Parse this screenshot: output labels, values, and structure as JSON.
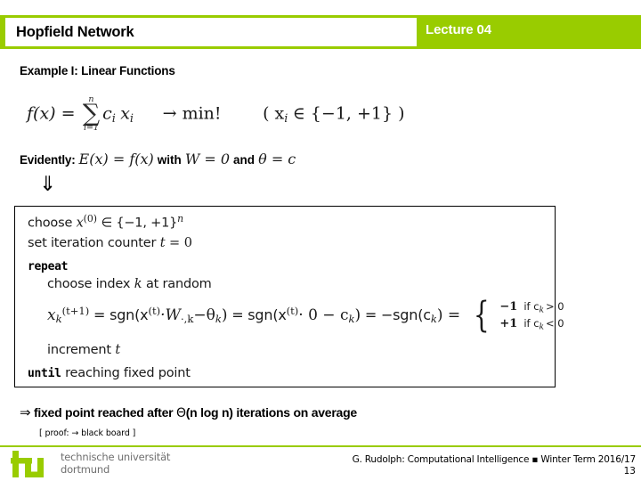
{
  "colors": {
    "accent_green": "#99CC00",
    "logo_gray": "#6f6f6f",
    "text": "#000000"
  },
  "header": {
    "title": "Hopfield Network",
    "lecture": "Lecture 04"
  },
  "content": {
    "example_heading": "Example I: Linear Functions",
    "formula_main": {
      "lhs": "f(x) =",
      "sum_upper": "n",
      "sum_sign": "∑",
      "sum_lower": "i=1",
      "summand_c": "c",
      "summand_c_sub": "i",
      "summand_x": "x",
      "summand_x_sub": "i",
      "objective": "→ min!",
      "constraint": "( x",
      "constraint_sub": "i",
      "constraint_rest": "∈ {−1, +1} )"
    },
    "evidently": {
      "label": "Evidently:",
      "expr_e": "E(x) = f(x)",
      "with": "with",
      "expr_w": "W = 0",
      "and": "and",
      "expr_theta": "θ = c"
    },
    "implication_arrow": "⇓"
  },
  "algorithm": {
    "line_choose": {
      "kw": "choose",
      "var": "x",
      "sup": "(0)",
      "rest": "∈ {−1, +1}",
      "rest_sup": "n"
    },
    "line_set_counter": {
      "kw": "set iteration counter",
      "var": "t",
      "rest": "= 0"
    },
    "line_repeat": "repeat",
    "line_choose_index": {
      "kw": "choose index",
      "var": "k",
      "rest": "at random"
    },
    "line_update": {
      "lhs_x": "x",
      "lhs_sub": "k",
      "lhs_sup": "(t+1)",
      "eq1": "= sgn(x",
      "eq1_sup": "(t)",
      "eq1_rest": "·W",
      "w_sub": "·,k",
      "eq1_tail": "−θ",
      "theta_sub": "k",
      "eq1_close": ")",
      "eq2": "= sgn(x",
      "eq2_sup": "(t)",
      "eq2_rest": "· 0 − c",
      "c_sub": "k",
      "eq2_close": ")",
      "eq3": "= −sgn(c",
      "eq3_sub": "k",
      "eq3_close": ") =",
      "case1_value": "−1",
      "case1_cond": "if c",
      "case1_cond_sub": "k",
      "case1_cond_rest": "> 0",
      "case2_value": "+1",
      "case2_cond": "if c",
      "case2_cond_sub": "k",
      "case2_cond_rest": "< 0"
    },
    "line_increment": {
      "kw": "increment",
      "var": "t"
    },
    "line_until": {
      "kw": "until",
      "rest": "reaching fixed point"
    }
  },
  "conclusion": {
    "arrow": "⇒",
    "text_before": "fixed point reached after",
    "complexity_symbol": "Θ",
    "complexity_arg": "(n log n)",
    "text_after": "iterations on average",
    "proof_note": "[ proof: → black board ]"
  },
  "footer": {
    "logo_line1": "technische universität",
    "logo_line2": "dortmund",
    "credit": "G. Rudolph: Computational Intelligence ▪ Winter Term 2016/17",
    "page_number": "13"
  }
}
